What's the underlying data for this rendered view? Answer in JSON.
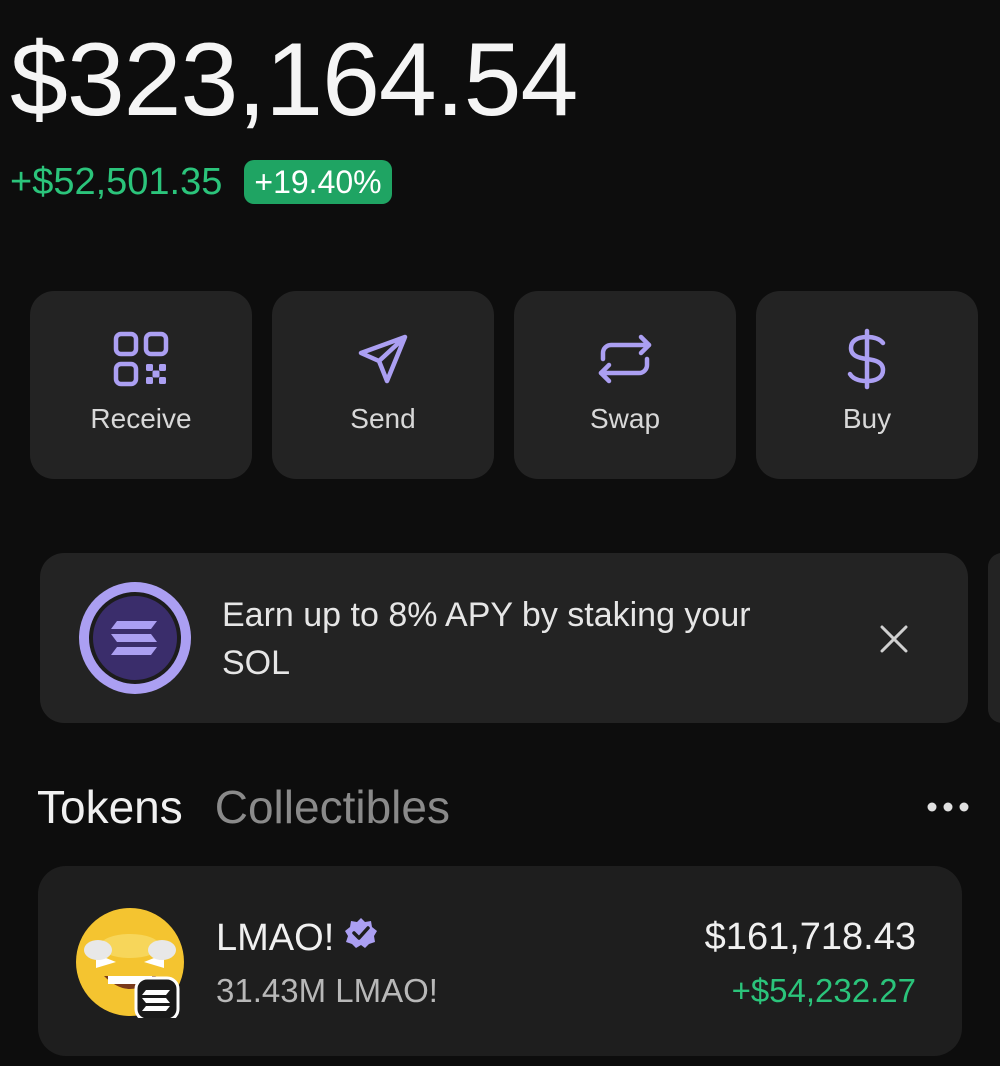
{
  "portfolio": {
    "balance": "$323,164.54",
    "change_amount": "+$52,501.35",
    "change_percent": "+19.40%"
  },
  "actions": [
    {
      "label": "Receive",
      "icon": "qr-code-icon"
    },
    {
      "label": "Send",
      "icon": "paper-plane-icon"
    },
    {
      "label": "Swap",
      "icon": "swap-arrows-icon"
    },
    {
      "label": "Buy",
      "icon": "dollar-icon"
    }
  ],
  "banner": {
    "text": "Earn up to 8% APY by staking your SOL",
    "icon": "solana-icon",
    "close_icon": "close-icon"
  },
  "tabs": {
    "active": "Tokens",
    "inactive": "Collectibles",
    "more_icon": "more-icon"
  },
  "tokens": [
    {
      "name": "LMAO!",
      "verified_icon": "verified-badge-icon",
      "quantity": "31.43M LMAO!",
      "value": "$161,718.43",
      "change": "+$54,232.27"
    }
  ],
  "colors": {
    "background": "#0d0d0d",
    "card": "#232323",
    "accent": "#ab9ff2",
    "positive": "#2bc47b",
    "badge": "#1fa463"
  }
}
